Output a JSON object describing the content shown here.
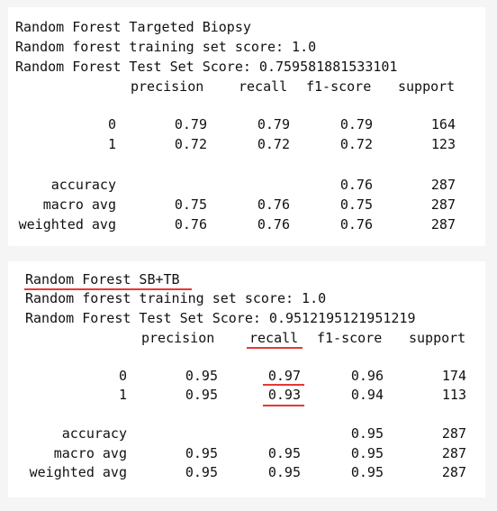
{
  "report_top": {
    "title": "Random Forest Targeted Biopsy",
    "train_line": "Random forest training set score: 1.0",
    "test_line": "Random Forest Test Set Score: 0.759581881533101",
    "headers": [
      "precision",
      "recall",
      "f1-score",
      "support"
    ],
    "rows": [
      {
        "label": "0",
        "precision": "0.79",
        "recall": "0.79",
        "f1": "0.79",
        "support": "164"
      },
      {
        "label": "1",
        "precision": "0.72",
        "recall": "0.72",
        "f1": "0.72",
        "support": "123"
      }
    ],
    "summary": [
      {
        "label": "accuracy",
        "precision": "",
        "recall": "",
        "f1": "0.76",
        "support": "287"
      },
      {
        "label": "macro avg",
        "precision": "0.75",
        "recall": "0.76",
        "f1": "0.75",
        "support": "287"
      },
      {
        "label": "weighted avg",
        "precision": "0.76",
        "recall": "0.76",
        "f1": "0.76",
        "support": "287"
      }
    ]
  },
  "report_bottom": {
    "title": "Random Forest SB+TB",
    "train_line": "Random forest training set score: 1.0",
    "test_line": "Random Forest Test Set Score: 0.9512195121951219",
    "headers": [
      "precision",
      "recall",
      "f1-score",
      "support"
    ],
    "rows": [
      {
        "label": "0",
        "precision": "0.95",
        "recall": "0.97",
        "f1": "0.96",
        "support": "174"
      },
      {
        "label": "1",
        "precision": "0.95",
        "recall": "0.93",
        "f1": "0.94",
        "support": "113"
      }
    ],
    "summary": [
      {
        "label": "accuracy",
        "precision": "",
        "recall": "",
        "f1": "0.95",
        "support": "287"
      },
      {
        "label": "macro avg",
        "precision": "0.95",
        "recall": "0.95",
        "f1": "0.95",
        "support": "287"
      },
      {
        "label": "weighted avg",
        "precision": "0.95",
        "recall": "0.95",
        "f1": "0.95",
        "support": "287"
      }
    ]
  },
  "colors": {
    "annotation_red": "#e53935",
    "panel_bg": "#ffffff",
    "page_bg": "#f5f5f5"
  }
}
